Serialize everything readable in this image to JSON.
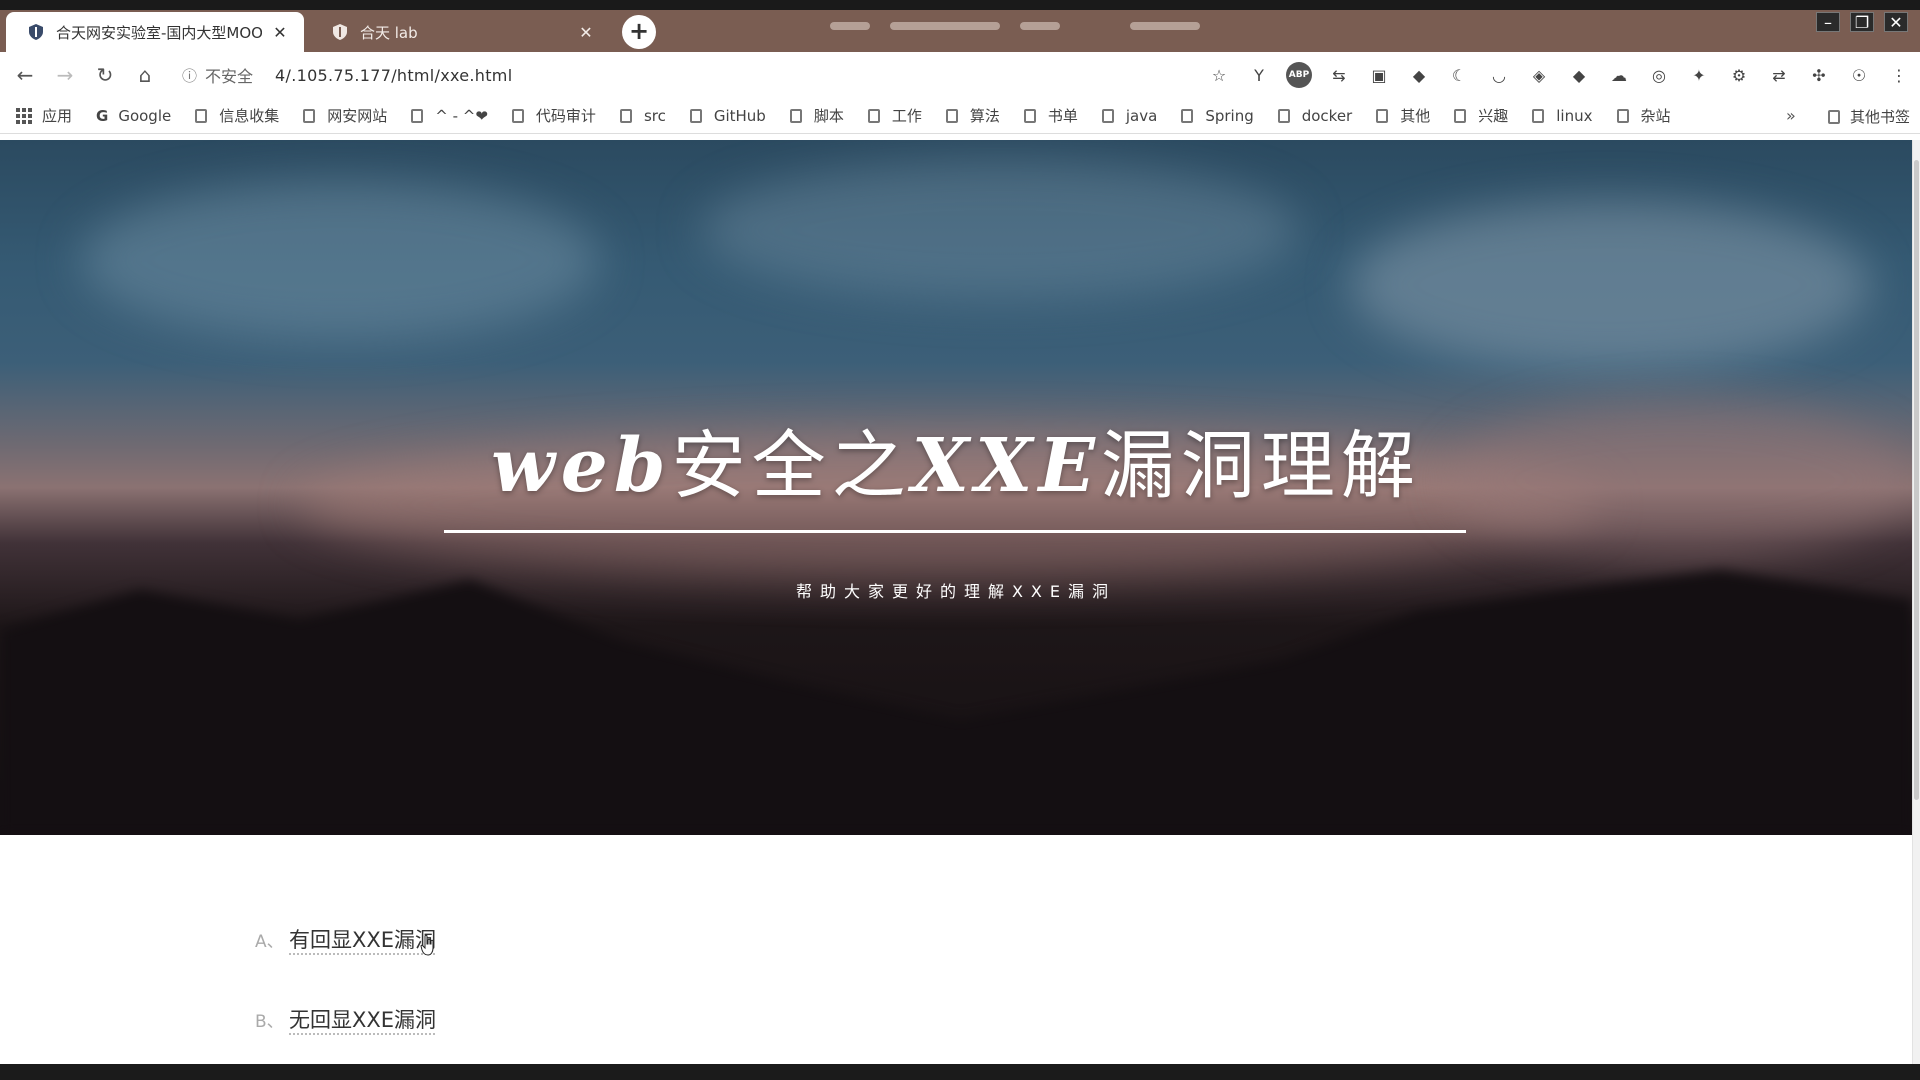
{
  "tabs": [
    {
      "title": "合天网安实验室-国内大型MOO",
      "active": true
    },
    {
      "title": "合天 lab",
      "active": false
    }
  ],
  "toolbar": {
    "security_label": "不安全",
    "url": "4/.105.75.177/html/xxe.html"
  },
  "bookmarks": [
    {
      "label": "应用",
      "icon": "apps-icon"
    },
    {
      "label": "Google",
      "icon": "google-icon"
    },
    {
      "label": "信息收集",
      "icon": "folder-icon"
    },
    {
      "label": "网安网站",
      "icon": "folder-icon"
    },
    {
      "label": "^ - ^❤",
      "icon": "folder-icon"
    },
    {
      "label": "代码审计",
      "icon": "folder-icon"
    },
    {
      "label": "src",
      "icon": "folder-icon"
    },
    {
      "label": "GitHub",
      "icon": "folder-icon"
    },
    {
      "label": "脚本",
      "icon": "folder-icon"
    },
    {
      "label": "工作",
      "icon": "folder-icon"
    },
    {
      "label": "算法",
      "icon": "folder-icon"
    },
    {
      "label": "书单",
      "icon": "folder-icon"
    },
    {
      "label": "java",
      "icon": "folder-icon"
    },
    {
      "label": "Spring",
      "icon": "folder-icon"
    },
    {
      "label": "docker",
      "icon": "folder-icon"
    },
    {
      "label": "其他",
      "icon": "folder-icon"
    },
    {
      "label": "兴趣",
      "icon": "folder-icon"
    },
    {
      "label": "linux",
      "icon": "folder-icon"
    },
    {
      "label": "杂站",
      "icon": "folder-icon"
    }
  ],
  "bookmarks_more": "»",
  "bookmarks_other": "其他书签",
  "hero": {
    "title_latin_1": "web",
    "title_cjk_1": "安全之",
    "title_latin_2": "XXE",
    "title_cjk_2": "漏洞理解",
    "subtitle": "帮助大家更好的理解XXE漏洞"
  },
  "toc": [
    {
      "number": "A、",
      "text": "有回显XXE漏洞"
    },
    {
      "number": "B、",
      "text": "无回显XXE漏洞"
    }
  ],
  "colors": {
    "tab_strip": "#7a5d52",
    "hero_sky": "#355a73",
    "hero_ground": "#140f12"
  }
}
